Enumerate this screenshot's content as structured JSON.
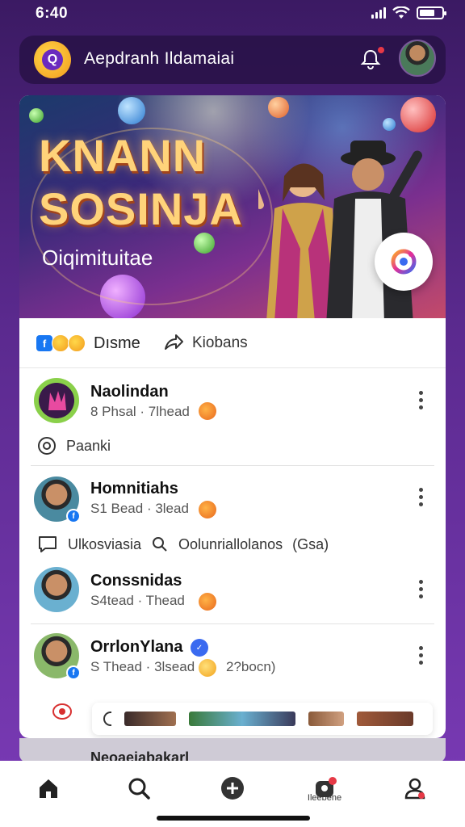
{
  "status_bar": {
    "time": "6:40",
    "battery_level": 0.6
  },
  "header": {
    "title": "Aepdranh Ildamaiai",
    "logo_icon": "app-logo",
    "notification_icon": "bell-icon",
    "avatar_icon": "profile-avatar"
  },
  "banner": {
    "title_line1": "KNANN",
    "title_line2": "SOSINJA",
    "subtitle": "Oiqimituitae",
    "fab_icon": "camera-icon"
  },
  "reaction_bar": {
    "react_label": "Dısme",
    "share_label": "Kiobans"
  },
  "feed": [
    {
      "name": "Naolindan",
      "meta": "8 Phsal · 7lhead",
      "sub_icon": "location-icon",
      "sub_text": "Paanki"
    },
    {
      "name": "Homnitiahs",
      "meta": "S1 Bead · 3lead",
      "sub_icon": "comment-icon",
      "sub_text": "Ulkosviasia",
      "sub_text_2": "Oolunriallolanos",
      "sub_text_3": "(Gsa)"
    },
    {
      "name": "Conssnidas",
      "meta": "S4tead · Thead"
    },
    {
      "name": "OrrlonYlana",
      "meta": "S Thead · 3lsead",
      "extra": "2?bocn)"
    }
  ],
  "peek_item": {
    "name": "Neoaeiabakarl"
  },
  "tab_bar": {
    "tabs": [
      {
        "icon": "home-icon"
      },
      {
        "icon": "search-icon"
      },
      {
        "icon": "add-icon"
      },
      {
        "icon": "notifications-icon",
        "label": "Ileebene"
      },
      {
        "icon": "profile-icon"
      }
    ]
  },
  "colors": {
    "accent": "#7b3bb7",
    "brand_blue": "#1877f2",
    "badge_red": "#e63946"
  }
}
